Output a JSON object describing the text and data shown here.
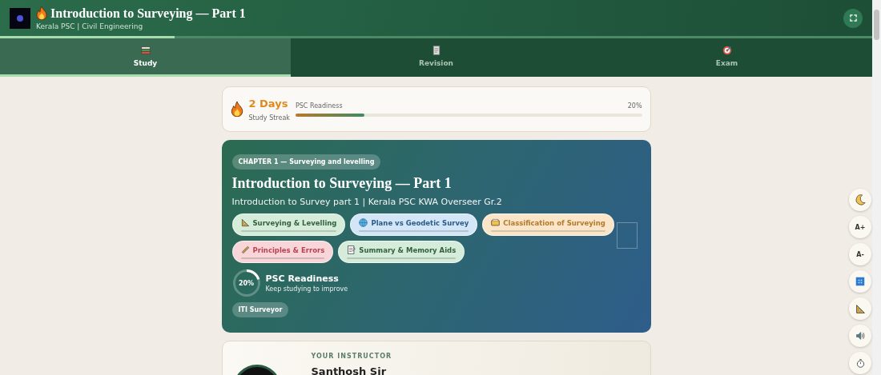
{
  "header": {
    "title": "Introduction to Surveying — Part 1",
    "subtitle": "Kerala PSC | Civil Engineering",
    "reading_progress": {
      "level": 0.2
    }
  },
  "tabs": [
    {
      "label": "Study",
      "selected": true
    },
    {
      "label": "Revision",
      "selected": false
    },
    {
      "label": "Exam",
      "selected": false
    }
  ],
  "streak": {
    "days": "2 Days",
    "caption": "Study Streak",
    "readiness_label": "PSC Readiness",
    "readiness_value": "20%",
    "level": 0.2
  },
  "hero": {
    "chapter": "CHAPTER 1 — Surveying and levelling",
    "title": "Introduction to Surveying — Part 1",
    "subtitle": "Introduction to Survey part 1 | Kerala PSC KWA Overseer Gr.2",
    "topics": [
      {
        "label": "Surveying & Levelling",
        "color": "#d4ecd9"
      },
      {
        "label": "Plane vs Geodetic Survey",
        "color": "#d3e6f7"
      },
      {
        "label": "Classification of Surveying",
        "color": "#fbe5c8"
      },
      {
        "label": "Principles & Errors",
        "color": "#f8d5d8"
      },
      {
        "label": "Summary & Memory Aids",
        "color": "#d4ecd9"
      }
    ],
    "readiness": {
      "value": "20%",
      "level": 0.2,
      "title": "PSC Readiness",
      "note": "Keep studying to improve"
    },
    "tag": "ITI Surveyor"
  },
  "instructor": {
    "label": "YOUR INSTRUCTOR",
    "name": "Santhosh Sir"
  },
  "side_tools": [
    {
      "kind": "icon"
    },
    {
      "kind": "text",
      "label": "A+"
    },
    {
      "kind": "text",
      "label": "A-"
    },
    {
      "kind": "icon"
    },
    {
      "kind": "icon"
    },
    {
      "kind": "icon"
    },
    {
      "kind": "icon"
    }
  ]
}
